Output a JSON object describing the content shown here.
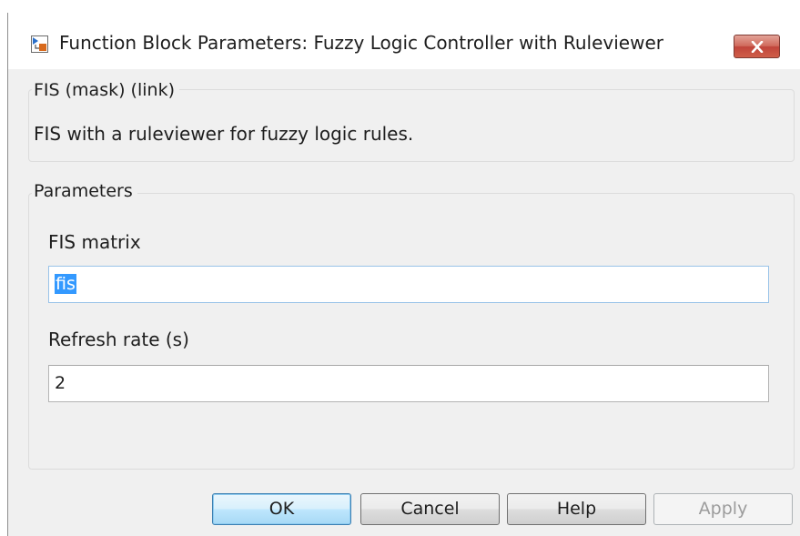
{
  "window": {
    "title": "Function Block Parameters: Fuzzy Logic Controller with Ruleviewer",
    "icon": "simulink-block-icon",
    "close_icon": "close-icon"
  },
  "mask_group": {
    "legend": "FIS (mask) (link)",
    "description": "FIS with a ruleviewer for fuzzy logic rules."
  },
  "parameters_group": {
    "legend": "Parameters",
    "fis_matrix": {
      "label": "FIS matrix",
      "value": "fis"
    },
    "refresh_rate": {
      "label": "Refresh rate (s)",
      "value": "2"
    }
  },
  "buttons": {
    "ok": "OK",
    "cancel": "Cancel",
    "help": "Help",
    "apply": "Apply"
  },
  "colors": {
    "close_button": "#c0443a",
    "selection": "#3399ff",
    "default_button_border": "#3c7fb1"
  }
}
